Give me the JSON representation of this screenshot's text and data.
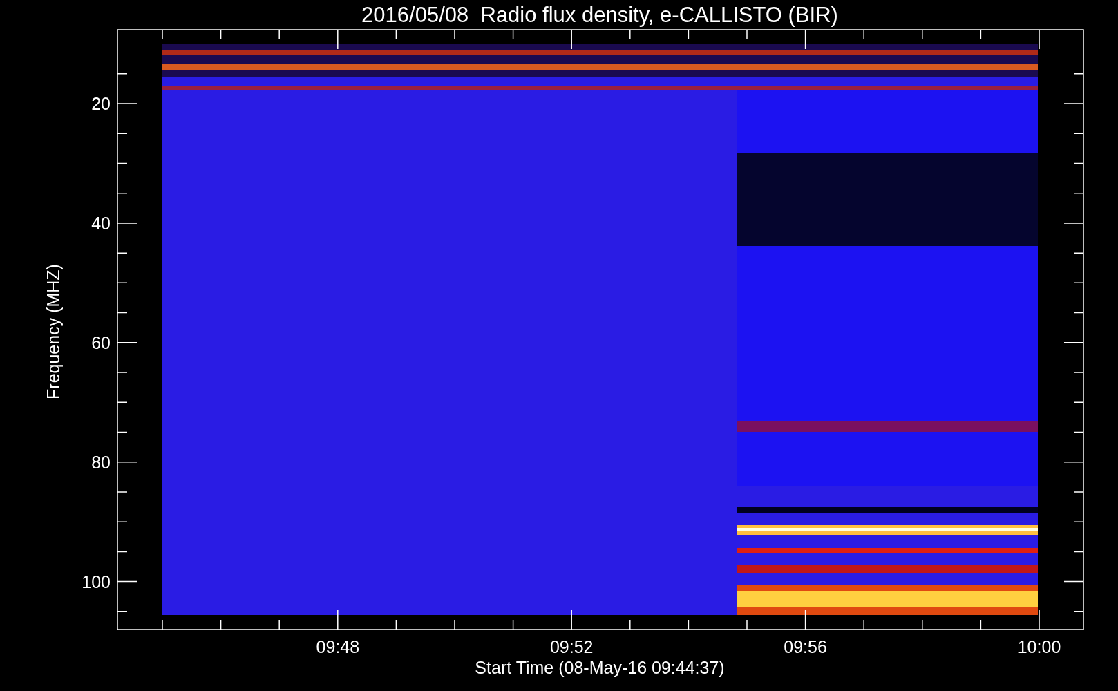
{
  "title": "2016/05/08  Radio flux density, e-CALLISTO (BIR)",
  "y_axis": {
    "label": "Frequency (MHZ)",
    "ticks": [
      "20",
      "40",
      "60",
      "80",
      "100"
    ]
  },
  "x_axis": {
    "label": "Start Time (08-May-16 09:44:37)",
    "ticks": [
      "09:48",
      "09:52",
      "09:56",
      "10:00"
    ]
  }
}
